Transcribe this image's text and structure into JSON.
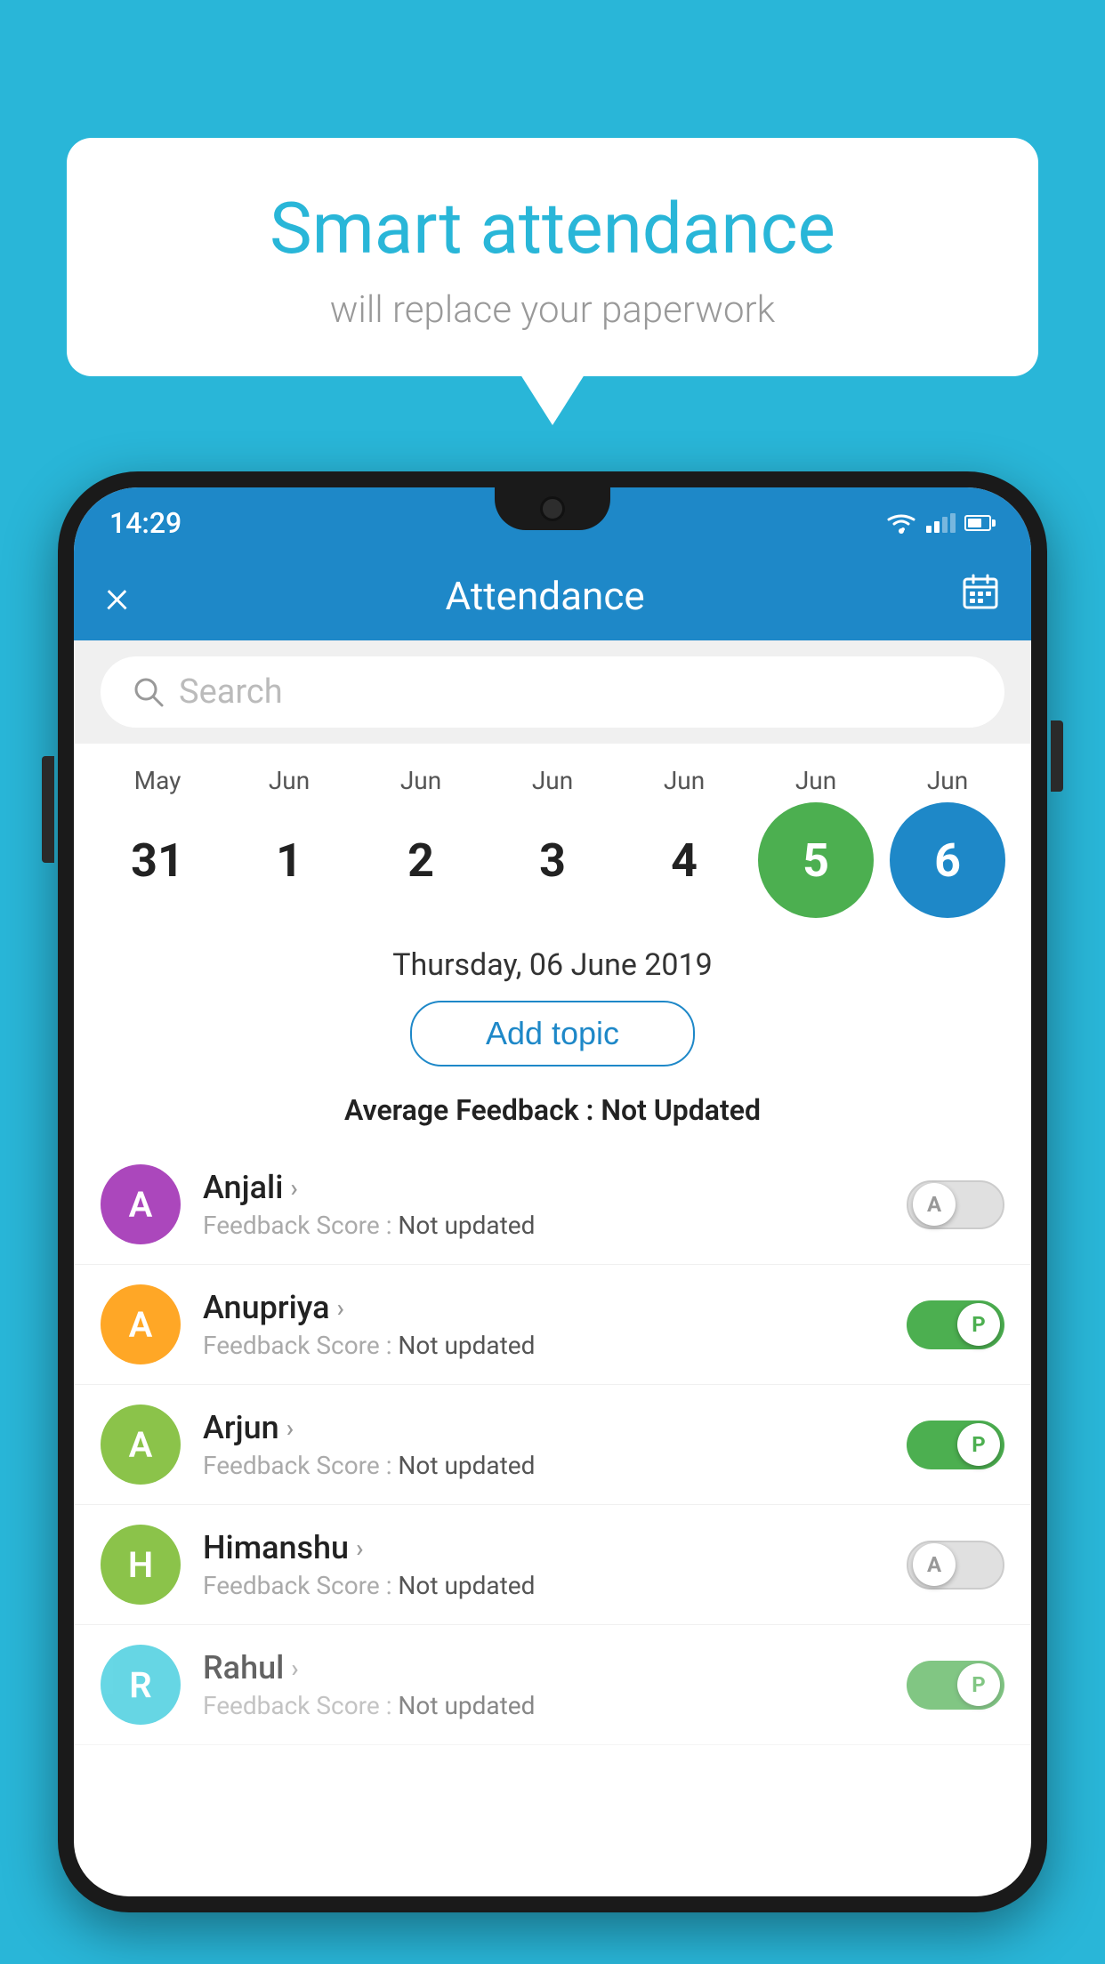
{
  "background_color": "#29b6d8",
  "bubble": {
    "title": "Smart attendance",
    "subtitle": "will replace your paperwork"
  },
  "status_bar": {
    "time": "14:29",
    "wifi": true,
    "signal": true,
    "battery": true
  },
  "app_bar": {
    "title": "Attendance",
    "close_label": "×",
    "calendar_label": "📅"
  },
  "search": {
    "placeholder": "Search"
  },
  "calendar": {
    "months": [
      "May",
      "Jun",
      "Jun",
      "Jun",
      "Jun",
      "Jun",
      "Jun"
    ],
    "days": [
      "31",
      "1",
      "2",
      "3",
      "4",
      "5",
      "6"
    ],
    "today_index": 5,
    "selected_index": 6
  },
  "selected_date": "Thursday, 06 June 2019",
  "add_topic_label": "Add topic",
  "avg_feedback_label": "Average Feedback : ",
  "avg_feedback_value": "Not Updated",
  "students": [
    {
      "name": "Anjali",
      "feedback_label": "Feedback Score : ",
      "feedback_value": "Not updated",
      "avatar_letter": "A",
      "avatar_color": "#ab47bc",
      "toggle_state": "off",
      "toggle_letter": "A"
    },
    {
      "name": "Anupriya",
      "feedback_label": "Feedback Score : ",
      "feedback_value": "Not updated",
      "avatar_letter": "A",
      "avatar_color": "#ffa726",
      "toggle_state": "on",
      "toggle_letter": "P"
    },
    {
      "name": "Arjun",
      "feedback_label": "Feedback Score : ",
      "feedback_value": "Not updated",
      "avatar_letter": "A",
      "avatar_color": "#8bc34a",
      "toggle_state": "on",
      "toggle_letter": "P"
    },
    {
      "name": "Himanshu",
      "feedback_label": "Feedback Score : ",
      "feedback_value": "Not updated",
      "avatar_letter": "H",
      "avatar_color": "#8bc34a",
      "toggle_state": "off",
      "toggle_letter": "A"
    },
    {
      "name": "Rahul",
      "feedback_label": "Feedback Score : ",
      "feedback_value": "Not updated",
      "avatar_letter": "R",
      "avatar_color": "#26c6da",
      "toggle_state": "on",
      "toggle_letter": "P"
    }
  ]
}
